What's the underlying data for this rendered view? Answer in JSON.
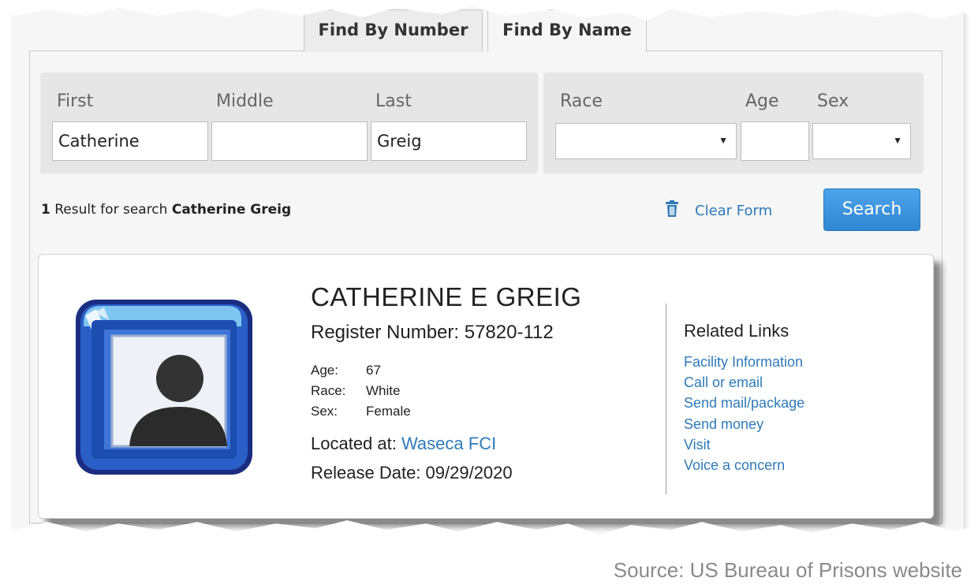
{
  "tabs": {
    "by_number": "Find By Number",
    "by_name": "Find By Name"
  },
  "form": {
    "first_label": "First",
    "middle_label": "Middle",
    "last_label": "Last",
    "race_label": "Race",
    "age_label": "Age",
    "sex_label": "Sex",
    "first_value": "Catherine",
    "middle_value": "",
    "last_value": "Greig",
    "race_value": "",
    "age_value": "",
    "sex_value": ""
  },
  "results": {
    "count": "1",
    "text": " Result for search ",
    "query": "Catherine Greig"
  },
  "actions": {
    "clear_label": "Clear Form",
    "search_label": "Search"
  },
  "record": {
    "name": "CATHERINE E GREIG",
    "register": "Register Number: 57820-112",
    "age_key": "Age:",
    "age_val": "67",
    "race_key": "Race:",
    "race_val": "White",
    "sex_key": "Sex:",
    "sex_val": "Female",
    "located_label": "Located at: ",
    "located_link": "Waseca FCI",
    "release": "Release Date: 09/29/2020"
  },
  "related": {
    "title": "Related Links",
    "links": [
      "Facility Information",
      "Call or email",
      "Send mail/package",
      "Send money",
      "Visit",
      "Voice a concern"
    ]
  },
  "source": "Source: US Bureau of Prisons website",
  "colors": {
    "link": "#2f7ab8",
    "button": "#3a93de",
    "avatar_blue": "#2a5fc7"
  },
  "icons": [
    "trash-icon",
    "avatar-icon",
    "caret-down-icon"
  ]
}
